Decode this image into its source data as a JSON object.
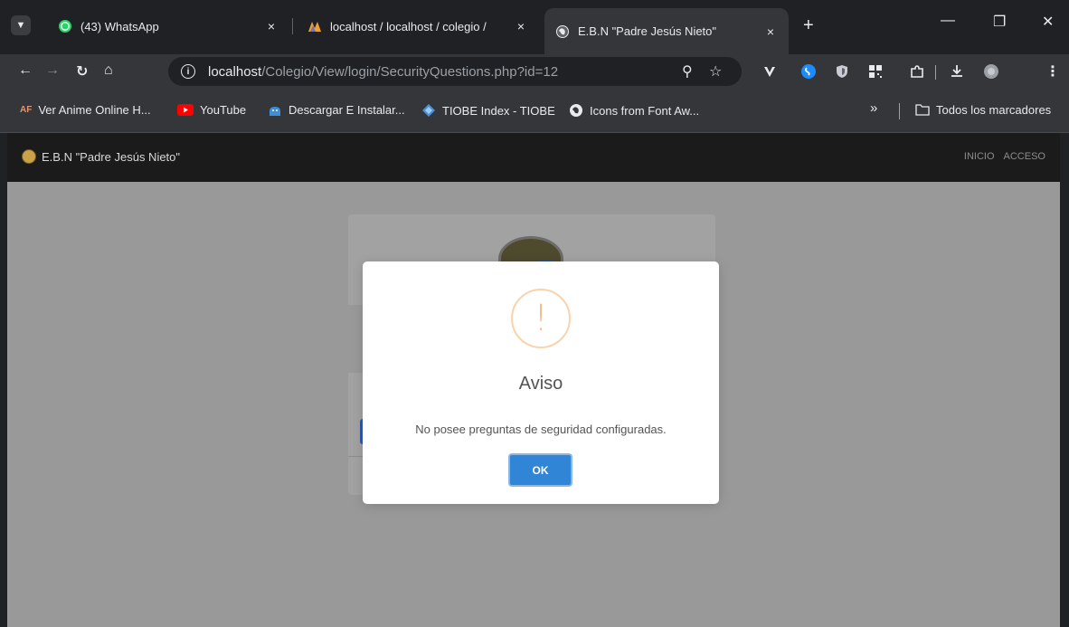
{
  "browser": {
    "tabs": [
      {
        "title": "(43) WhatsApp",
        "close": "×"
      },
      {
        "title": "localhost / localhost / colegio /",
        "close": "×"
      },
      {
        "title": "E.B.N \"Padre Jesús Nieto\"",
        "close": "×"
      }
    ],
    "new_tab": "+",
    "window_controls": {
      "minimize": "—",
      "restore": "❐",
      "close": "✕"
    },
    "url_host": "localhost",
    "url_path": "/Colegio/View/login/SecurityQuestions.php?id=12",
    "bookmarks": [
      {
        "label": "Ver Anime Online H...",
        "icon": "AF"
      },
      {
        "label": "YouTube",
        "icon": "youtube-icon"
      },
      {
        "label": "Descargar E Instalar...",
        "icon": "android-icon"
      },
      {
        "label": "TIOBE Index - TIOBE",
        "icon": "tiobe-icon"
      },
      {
        "label": "Icons from Font Aw...",
        "icon": "fontawesome-icon"
      }
    ],
    "bookmarks_overflow": "»",
    "all_bookmarks": "Todos los marcadores"
  },
  "site": {
    "brand": "E.B.N \"Padre Jesús Nieto\"",
    "nav": [
      "INICIO",
      "ACCESO"
    ]
  },
  "modal": {
    "icon": "!",
    "title": "Aviso",
    "text": "No posee preguntas de seguridad configuradas.",
    "ok_label": "OK"
  },
  "colors": {
    "accent": "#3085d6",
    "warning": "#f8bb86",
    "overlay": "#999999"
  }
}
